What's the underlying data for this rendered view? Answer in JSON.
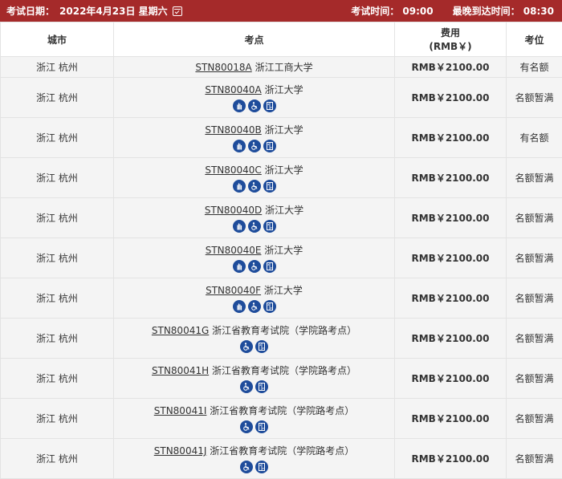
{
  "header": {
    "exam_date_label": "考试日期：",
    "exam_date": "2022年4月23日 星期六",
    "exam_time_label": "考试时间：",
    "exam_time": "09:00",
    "latest_arrival_label": "最晚到达时间：",
    "latest_arrival": "08:30"
  },
  "columns": {
    "city": "城市",
    "center": "考点",
    "fee_line1": "费用",
    "fee_line2": "(RMB￥)",
    "seats": "考位"
  },
  "rows": [
    {
      "city": "浙江 杭州",
      "code": "STN80018A",
      "name": "浙江工商大学",
      "fee": "RMB￥2100.00",
      "status": "有名额",
      "icons": []
    },
    {
      "city": "浙江 杭州",
      "code": "STN80040A",
      "name": "浙江大学",
      "fee": "RMB￥2100.00",
      "status": "名额暂满",
      "icons": [
        "hand-icon",
        "wheelchair-icon",
        "elevator-icon"
      ]
    },
    {
      "city": "浙江 杭州",
      "code": "STN80040B",
      "name": "浙江大学",
      "fee": "RMB￥2100.00",
      "status": "有名额",
      "icons": [
        "hand-icon",
        "wheelchair-icon",
        "elevator-icon"
      ]
    },
    {
      "city": "浙江 杭州",
      "code": "STN80040C",
      "name": "浙江大学",
      "fee": "RMB￥2100.00",
      "status": "名额暂满",
      "icons": [
        "hand-icon",
        "wheelchair-icon",
        "elevator-icon"
      ]
    },
    {
      "city": "浙江 杭州",
      "code": "STN80040D",
      "name": "浙江大学",
      "fee": "RMB￥2100.00",
      "status": "名额暂满",
      "icons": [
        "hand-icon",
        "wheelchair-icon",
        "elevator-icon"
      ]
    },
    {
      "city": "浙江 杭州",
      "code": "STN80040E",
      "name": "浙江大学",
      "fee": "RMB￥2100.00",
      "status": "名额暂满",
      "icons": [
        "hand-icon",
        "wheelchair-icon",
        "elevator-icon"
      ]
    },
    {
      "city": "浙江 杭州",
      "code": "STN80040F",
      "name": "浙江大学",
      "fee": "RMB￥2100.00",
      "status": "名额暂满",
      "icons": [
        "hand-icon",
        "wheelchair-icon",
        "elevator-icon"
      ]
    },
    {
      "city": "浙江 杭州",
      "code": "STN80041G",
      "name": "浙江省教育考试院（学院路考点）",
      "fee": "RMB￥2100.00",
      "status": "名额暂满",
      "icons": [
        "wheelchair-icon",
        "elevator-icon"
      ]
    },
    {
      "city": "浙江 杭州",
      "code": "STN80041H",
      "name": "浙江省教育考试院（学院路考点）",
      "fee": "RMB￥2100.00",
      "status": "名额暂满",
      "icons": [
        "wheelchair-icon",
        "elevator-icon"
      ]
    },
    {
      "city": "浙江 杭州",
      "code": "STN80041I",
      "name": "浙江省教育考试院（学院路考点）",
      "fee": "RMB￥2100.00",
      "status": "名额暂满",
      "icons": [
        "wheelchair-icon",
        "elevator-icon"
      ]
    },
    {
      "city": "浙江 杭州",
      "code": "STN80041J",
      "name": "浙江省教育考试院（学院路考点）",
      "fee": "RMB￥2100.00",
      "status": "名额暂满",
      "icons": [
        "wheelchair-icon",
        "elevator-icon"
      ]
    }
  ],
  "colors": {
    "header_bg": "#a52a2a",
    "icon_bg": "#1e4c9b",
    "row_bg": "#f4f4f4"
  }
}
